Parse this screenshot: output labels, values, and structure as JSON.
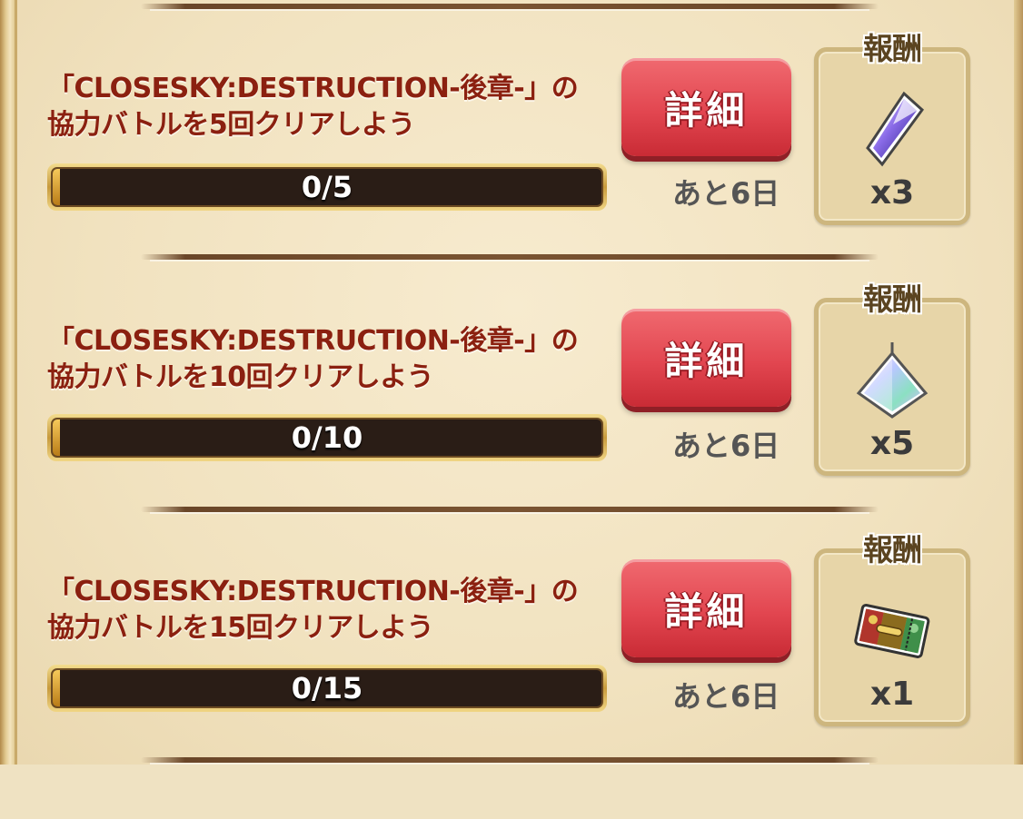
{
  "reward_label": "報酬",
  "detail_label": "詳細",
  "missions": [
    {
      "title": "「CLOSESKY:DESTRUCTION-後章-」の協力バトルを5回クリアしよう",
      "progress_text": "0/5",
      "progress_fraction": 0,
      "remaining": "あと6日",
      "reward_icon": "purple-crystal-icon",
      "reward_count": "x3"
    },
    {
      "title": "「CLOSESKY:DESTRUCTION-後章-」の協力バトルを10回クリアしよう",
      "progress_text": "0/10",
      "progress_fraction": 0,
      "remaining": "あと6日",
      "reward_icon": "diamond-pendant-icon",
      "reward_count": "x5"
    },
    {
      "title": "「CLOSESKY:DESTRUCTION-後章-」の協力バトルを15回クリアしよう",
      "progress_text": "0/15",
      "progress_fraction": 0,
      "remaining": "あと6日",
      "reward_icon": "ticket-icon",
      "reward_count": "x1"
    }
  ]
}
